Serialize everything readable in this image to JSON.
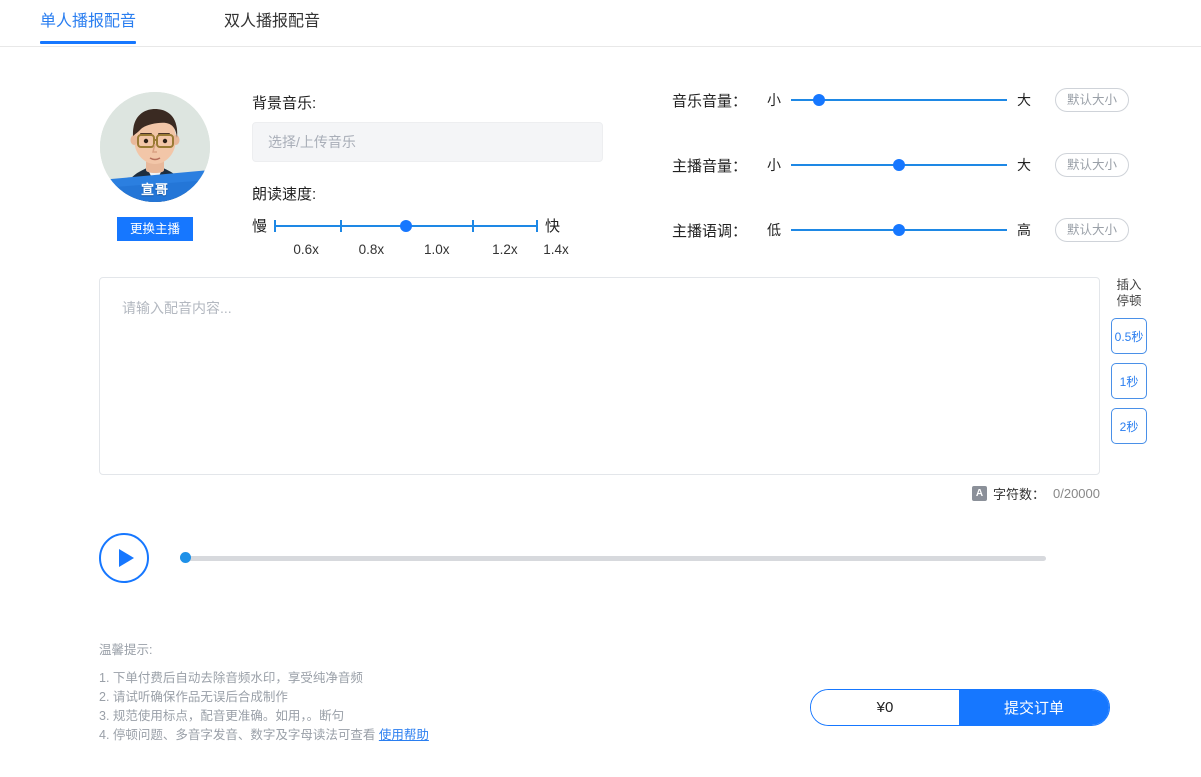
{
  "tabs": [
    {
      "label": "单人播报配音",
      "active": true
    },
    {
      "label": "双人播报配音",
      "active": false
    }
  ],
  "host": {
    "name": "宣哥",
    "change_button": "更换主播"
  },
  "background_music": {
    "label": "背景音乐:",
    "placeholder": "选择/上传音乐",
    "value": ""
  },
  "speed": {
    "label": "朗读速度:",
    "min_label": "慢",
    "max_label": "快",
    "ticks": [
      "0.6x",
      "0.8x",
      "1.0x",
      "1.2x",
      "1.4x"
    ],
    "selected": "1.0x",
    "handle_percent": 50
  },
  "controls": [
    {
      "label": "音乐音量：",
      "min_label": "小",
      "max_label": "大",
      "handle_percent": 13,
      "default_button": "默认大小"
    },
    {
      "label": "主播音量：",
      "min_label": "小",
      "max_label": "大",
      "handle_percent": 50,
      "default_button": "默认大小"
    },
    {
      "label": "主播语调：",
      "min_label": "低",
      "max_label": "高",
      "handle_percent": 50,
      "default_button": "默认大小"
    }
  ],
  "editor": {
    "placeholder": "请输入配音内容...",
    "value": ""
  },
  "pause_rail": {
    "title_line1": "插入",
    "title_line2": "停顿",
    "buttons": [
      "0.5秒",
      "1秒",
      "2秒"
    ]
  },
  "counter": {
    "icon": "A",
    "label": "字符数：",
    "value": "0/20000"
  },
  "player": {
    "play_icon": "play-icon",
    "progress_percent": 0
  },
  "tips": {
    "title": "温馨提示:",
    "items": [
      "1. 下单付费后自动去除音频水印，享受纯净音频",
      "2. 请试听确保作品无误后合成制作",
      "3. 规范使用标点，配音更准确。如用，。断句",
      "4. 停顿问题、多音字发音、数字及字母读法可查看 "
    ],
    "help_link": "使用帮助"
  },
  "order": {
    "price": "¥0",
    "submit": "提交订单"
  },
  "colors": {
    "primary": "#1677ff",
    "tab_active": "#2a7ef0",
    "slider": "#1e88e5",
    "muted": "#9aa0a8"
  }
}
